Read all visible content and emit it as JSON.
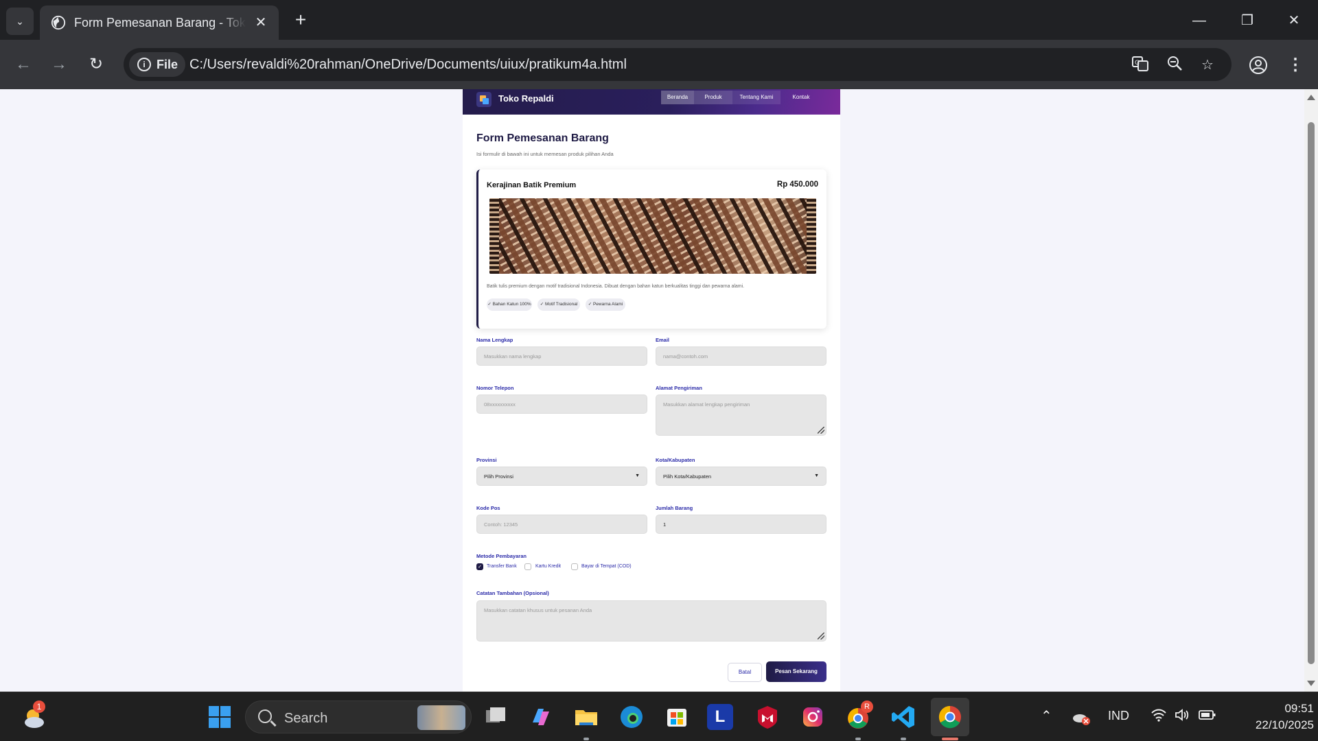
{
  "browser": {
    "tab_title": "Form Pemesanan Barang - Toko Repaldi",
    "file_chip": "File",
    "url": "C:/Users/revaldi%20rahman/OneDrive/Documents/uiux/pratikum4a.html",
    "icons": [
      "tab-list-icon",
      "globe-icon",
      "close-icon",
      "plus-icon",
      "minimize-icon",
      "restore-icon",
      "close-window-icon",
      "back-icon",
      "forward-icon",
      "reload-icon",
      "info-icon",
      "translate-icon",
      "zoom-icon",
      "star-icon",
      "profile-icon",
      "kebab-menu-icon"
    ]
  },
  "site": {
    "brand": "Toko Repaldi",
    "nav": [
      "Beranda",
      "Produk",
      "Tentang Kami",
      "Kontak"
    ]
  },
  "form": {
    "title": "Form Pemesanan Barang",
    "subtitle": "Isi formulir di bawah ini untuk memesan produk pilihan Anda",
    "product": {
      "name": "Kerajinan Batik Premium",
      "price": "Rp 450.000",
      "description": "Batik tulis premium dengan motif tradisional Indonesia. Dibuat dengan bahan katun berkualitas tinggi dan pewarna alami.",
      "tags": [
        "✓ Bahan Katun 100%",
        "✓ Motif Tradisional",
        "✓ Pewarna Alami"
      ]
    },
    "fields": {
      "nama": {
        "label": "Nama Lengkap",
        "placeholder": "Masukkan nama lengkap"
      },
      "email": {
        "label": "Email",
        "placeholder": "nama@contoh.com"
      },
      "telepon": {
        "label": "Nomor Telepon",
        "placeholder": "08xxxxxxxxxx"
      },
      "alamat": {
        "label": "Alamat Pengiriman",
        "placeholder": "Masukkan alamat lengkap pengiriman"
      },
      "provinsi": {
        "label": "Provinsi",
        "value": "Pilih Provinsi"
      },
      "kota": {
        "label": "Kota/Kabupaten",
        "value": "Pilih Kota/Kabupaten"
      },
      "kodepos": {
        "label": "Kode Pos",
        "placeholder": "Contoh: 12345"
      },
      "jumlah": {
        "label": "Jumlah Barang",
        "value": "1"
      },
      "catatan": {
        "label": "Catatan Tambahan (Opsional)",
        "placeholder": "Masukkan catatan khusus untuk pesanan Anda"
      }
    },
    "payment": {
      "label": "Metode Pembayaran",
      "options": [
        "Transfer Bank",
        "Kartu Kredit",
        "Bayar di Tempat (COD)"
      ],
      "selected": "Transfer Bank"
    },
    "buttons": {
      "cancel": "Batal",
      "submit": "Pesan Sekarang"
    }
  },
  "taskbar": {
    "weather_badge": "1",
    "search": "Search",
    "language": "IND",
    "time": "09:51",
    "date": "22/10/2025",
    "chrome_badge": "R",
    "app_letter": "L"
  },
  "colors": {
    "accent": "#1f1b45",
    "label": "#2a2aa8",
    "header_gradient_end": "#7a2a9b"
  }
}
